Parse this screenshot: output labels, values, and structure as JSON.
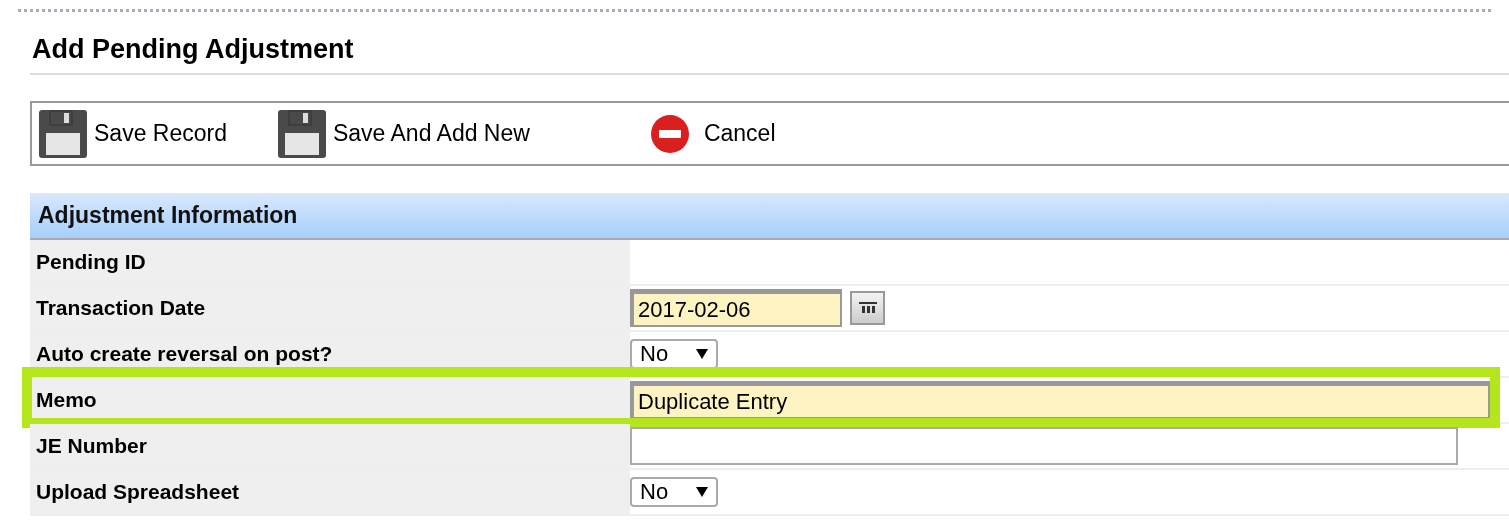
{
  "page": {
    "title": "Add Pending Adjustment"
  },
  "toolbar": [
    {
      "kind": "save",
      "label": "Save Record"
    },
    {
      "kind": "save",
      "label": "Save And Add New"
    },
    {
      "kind": "cancel",
      "label": "Cancel"
    }
  ],
  "section": {
    "title": "Adjustment Information",
    "rows": [
      {
        "label": "Pending ID",
        "kind": "readonly",
        "outlined": false
      },
      {
        "label": "Transaction Date",
        "kind": "date",
        "value": "2017-02-06",
        "outlined": false
      },
      {
        "label": "Auto create reversal on post?",
        "kind": "select",
        "value": "No",
        "outlined": false
      },
      {
        "label": "Memo",
        "kind": "wide-input",
        "value": "Duplicate Entry",
        "outlined": true
      },
      {
        "label": "JE Number",
        "kind": "input",
        "outlined": false
      },
      {
        "label": "Upload Spreadsheet",
        "kind": "select",
        "value": "No",
        "outlined": false
      }
    ]
  }
}
